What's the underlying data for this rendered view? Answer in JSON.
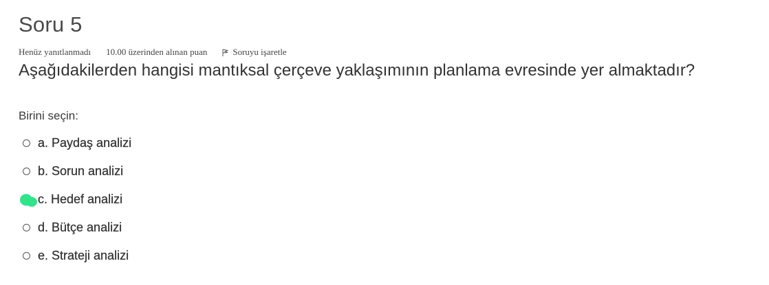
{
  "question": {
    "title": "Soru 5",
    "state": "Henüz yanıtlanmadı",
    "grade": "10.00 üzerinden alınan puan",
    "flag_label": "Soruyu işaretle",
    "text": "Aşağıdakilerden hangisi mantıksal çerçeve yaklaşımının planlama evresinde yer almaktadır?",
    "prompt": "Birini seçin:"
  },
  "answers": [
    {
      "label": "a. Paydaş analizi",
      "selected": false
    },
    {
      "label": "b. Sorun analizi",
      "selected": false
    },
    {
      "label": "c. Hedef analizi",
      "selected": false
    },
    {
      "label": "d. Bütçe analizi",
      "selected": false
    },
    {
      "label": "e. Strateji analizi",
      "selected": false
    }
  ],
  "colors": {
    "cursor_highlight": "#2ee58a",
    "text": "#333333"
  },
  "icons": {
    "flag": "flag-icon",
    "cursor": "cursor-highlight"
  }
}
